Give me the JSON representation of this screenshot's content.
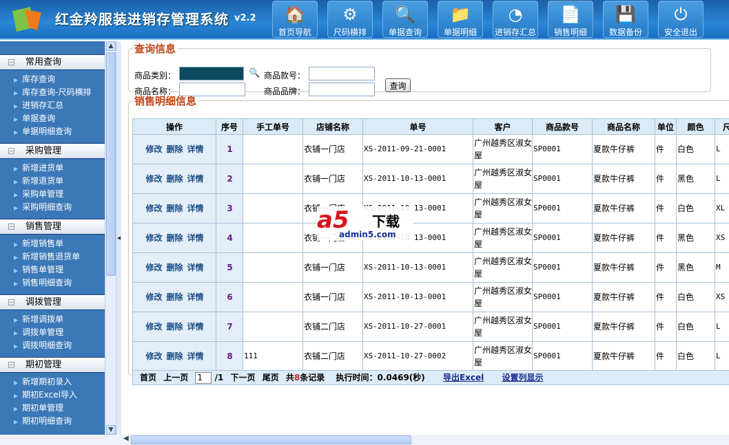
{
  "app": {
    "title": "红金羚服装进销存管理系统",
    "version": "v2.2"
  },
  "nav": [
    {
      "label": "首页导航",
      "icon": "home-icon"
    },
    {
      "label": "尺码横排",
      "icon": "gears-icon"
    },
    {
      "label": "单据查询",
      "icon": "magnifier-icon"
    },
    {
      "label": "单据明细",
      "icon": "checked-folder-icon"
    },
    {
      "label": "进销存汇总",
      "icon": "pie-chart-icon"
    },
    {
      "label": "销售明细",
      "icon": "checked-document-icon",
      "active": true
    },
    {
      "label": "数据备份",
      "icon": "floppy-disk-icon"
    },
    {
      "label": "安全退出",
      "icon": "power-icon"
    }
  ],
  "sidebar": [
    {
      "title": "常用查询",
      "items": [
        "库存查询",
        "库存查询-尺码横排",
        "进销存汇总",
        "单据查询",
        "单据明细查询"
      ]
    },
    {
      "title": "采购管理",
      "items": [
        "新增进货单",
        "新增退货单",
        "采购单管理",
        "采购明细查询"
      ]
    },
    {
      "title": "销售管理",
      "items": [
        "新增销售单",
        "新增销售退货单",
        "销售单管理",
        "销售明细查询"
      ]
    },
    {
      "title": "调拨管理",
      "items": [
        "新增调拨单",
        "调拨单管理",
        "调拨明细查询"
      ]
    },
    {
      "title": "期初管理",
      "items": [
        "新增期初录入",
        "期初Excel导入",
        "期初单管理",
        "期初明细查询"
      ]
    }
  ],
  "query": {
    "legend": "查询信息",
    "category_label": "商品类别：",
    "style_no_label": "商品款号：",
    "name_label": "商品名称：",
    "brand_label": "商品品牌：",
    "category_value": "",
    "style_no_value": "",
    "name_value": "",
    "brand_value": "",
    "button": "查询"
  },
  "sales": {
    "legend": "销售明细信息",
    "columns": [
      "操作",
      "序号",
      "手工单号",
      "店铺名称",
      "单号",
      "客户",
      "商品款号",
      "商品名称",
      "单位",
      "颜色",
      "尺"
    ],
    "actions": [
      "修改",
      "删除",
      "详情"
    ],
    "rows": [
      {
        "no": "1",
        "manual": "",
        "store": "衣铺一门店",
        "order": "XS-2011-09-21-0001",
        "customer": "广州越秀区淑女屋",
        "style": "SP0001",
        "name": "夏款牛仔裤",
        "unit": "件",
        "color": "白色",
        "size": "L"
      },
      {
        "no": "2",
        "manual": "",
        "store": "衣铺一门店",
        "order": "XS-2011-10-13-0001",
        "customer": "广州越秀区淑女屋",
        "style": "SP0001",
        "name": "夏款牛仔裤",
        "unit": "件",
        "color": "黑色",
        "size": "L"
      },
      {
        "no": "3",
        "manual": "",
        "store": "衣铺一门店",
        "order": "XS-2011-10-13-0001",
        "customer": "广州越秀区淑女屋",
        "style": "SP0001",
        "name": "夏款牛仔裤",
        "unit": "件",
        "color": "白色",
        "size": "XL"
      },
      {
        "no": "4",
        "manual": "",
        "store": "衣铺一门店",
        "order": "XS-2011-10-13-0001",
        "customer": "广州越秀区淑女屋",
        "style": "SP0001",
        "name": "夏款牛仔裤",
        "unit": "件",
        "color": "黑色",
        "size": "XS"
      },
      {
        "no": "5",
        "manual": "",
        "store": "衣铺一门店",
        "order": "XS-2011-10-13-0001",
        "customer": "广州越秀区淑女屋",
        "style": "SP0001",
        "name": "夏款牛仔裤",
        "unit": "件",
        "color": "黑色",
        "size": "M"
      },
      {
        "no": "6",
        "manual": "",
        "store": "衣铺一门店",
        "order": "XS-2011-10-13-0001",
        "customer": "广州越秀区淑女屋",
        "style": "SP0001",
        "name": "夏款牛仔裤",
        "unit": "件",
        "color": "白色",
        "size": "XS"
      },
      {
        "no": "7",
        "manual": "",
        "store": "衣铺二门店",
        "order": "XS-2011-10-27-0001",
        "customer": "广州越秀区淑女屋",
        "style": "SP0001",
        "name": "夏款牛仔裤",
        "unit": "件",
        "color": "白色",
        "size": "L"
      },
      {
        "no": "8",
        "manual": "111",
        "store": "衣铺二门店",
        "order": "XS-2011-10-27-0002",
        "customer": "广州越秀区淑女屋",
        "style": "SP0001",
        "name": "夏款牛仔裤",
        "unit": "件",
        "color": "白色",
        "size": "L"
      }
    ]
  },
  "pager": {
    "first": "首页",
    "prev": "上一页",
    "page": "1",
    "total_pages": "/1",
    "next": "下一页",
    "last": "尾页",
    "total_prefix": "共",
    "total": "8",
    "total_suffix": "条记录",
    "exec_label": "执行时间：0.0469(秒)",
    "export": "导出Excel",
    "columns_setting": "设置列显示"
  },
  "watermark": {
    "logo": "a5",
    "text": "下载",
    "url": "admin5.com"
  }
}
